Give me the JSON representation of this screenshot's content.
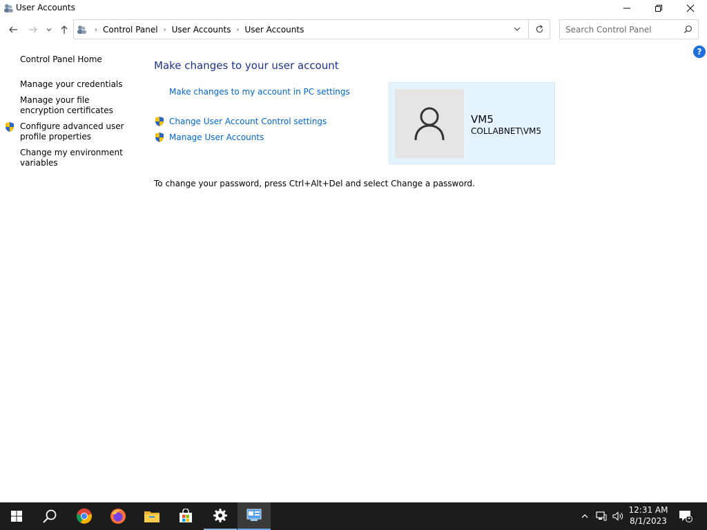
{
  "window": {
    "title": "User Accounts",
    "minimize_icon": "minimize-icon",
    "maximize_icon": "restore-icon",
    "close_icon": "close-icon"
  },
  "address_bar": {
    "breadcrumbs": [
      "Control Panel",
      "User Accounts",
      "User Accounts"
    ],
    "search_placeholder": "Search Control Panel"
  },
  "left_pane": {
    "home": "Control Panel Home",
    "links": [
      "Manage your credentials",
      "Manage your file encryption certificates",
      "Configure advanced user profile properties",
      "Change my environment variables"
    ]
  },
  "main": {
    "heading": "Make changes to your user account",
    "pc_settings_link": "Make changes to my account in PC settings",
    "uac_link": "Change User Account Control settings",
    "manage_link": "Manage User Accounts",
    "password_note": "To change your password, press Ctrl+Alt+Del and select Change a password."
  },
  "user": {
    "name": "VM5",
    "account": "COLLABNET\\VM5"
  },
  "taskbar": {
    "time": "12:31 AM",
    "date": "8/1/2023",
    "notification_count": "1"
  },
  "colors": {
    "link": "#0066cc",
    "heading": "#1e3287",
    "card": "#e5f3ff",
    "taskbar": "#1c1c1c"
  }
}
